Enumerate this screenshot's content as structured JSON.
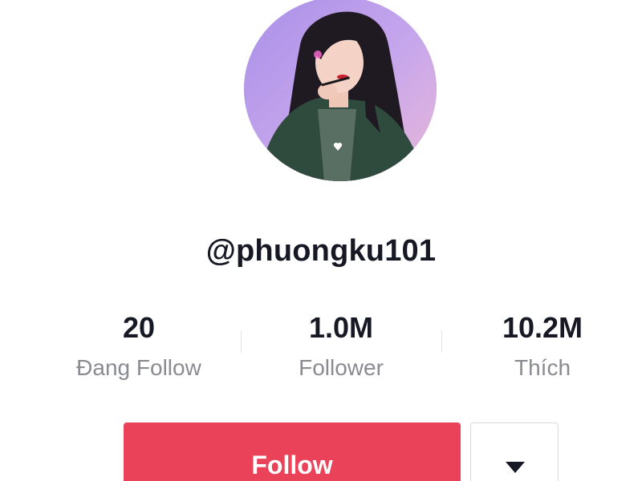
{
  "profile": {
    "username": "@phuongku101",
    "avatar_icon": "profile-photo"
  },
  "stats": {
    "following": {
      "value": "20",
      "label": "Đang Follow"
    },
    "followers": {
      "value": "1.0M",
      "label": "Follower"
    },
    "likes": {
      "value": "10.2M",
      "label": "Thích"
    }
  },
  "actions": {
    "follow_label": "Follow",
    "more_icon": "caret-down-icon"
  },
  "colors": {
    "accent": "#ea4359",
    "text_primary": "#161823",
    "text_secondary": "#8a8b91",
    "divider": "#e3e3e4"
  }
}
